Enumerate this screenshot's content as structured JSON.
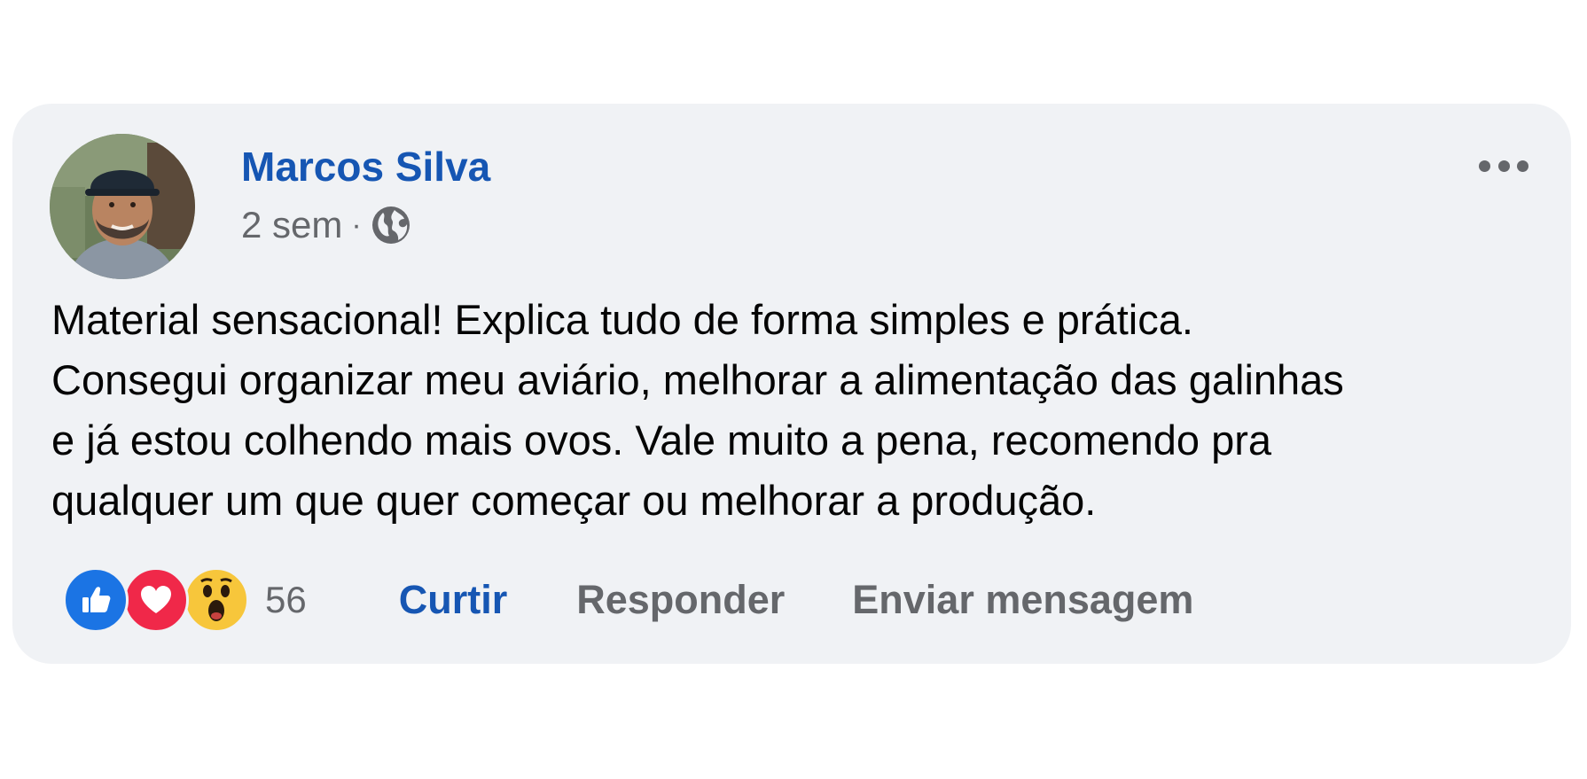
{
  "post": {
    "author": "Marcos Silva",
    "time": "2 sem",
    "separator": "·",
    "privacy_icon": "globe-icon",
    "text": "Material sensacional! Explica tudo de forma simples e prática.\nConsegui organizar meu aviário, melhorar a alimentação das galinhas\ne já estou colhendo mais ovos. Vale muito a pena, recomendo pra\nqualquer um que quer começar ou melhorar a produção."
  },
  "reactions": {
    "icons": [
      "like-icon",
      "love-icon",
      "wow-icon"
    ],
    "count": "56"
  },
  "actions": {
    "like": "Curtir",
    "reply": "Responder",
    "message": "Enviar mensagem"
  },
  "colors": {
    "card_bg": "#f0f2f5",
    "author": "#1656b3",
    "muted": "#65676b",
    "like": "#1b74e4",
    "love": "#f02849",
    "wow": "#f7c63b"
  }
}
